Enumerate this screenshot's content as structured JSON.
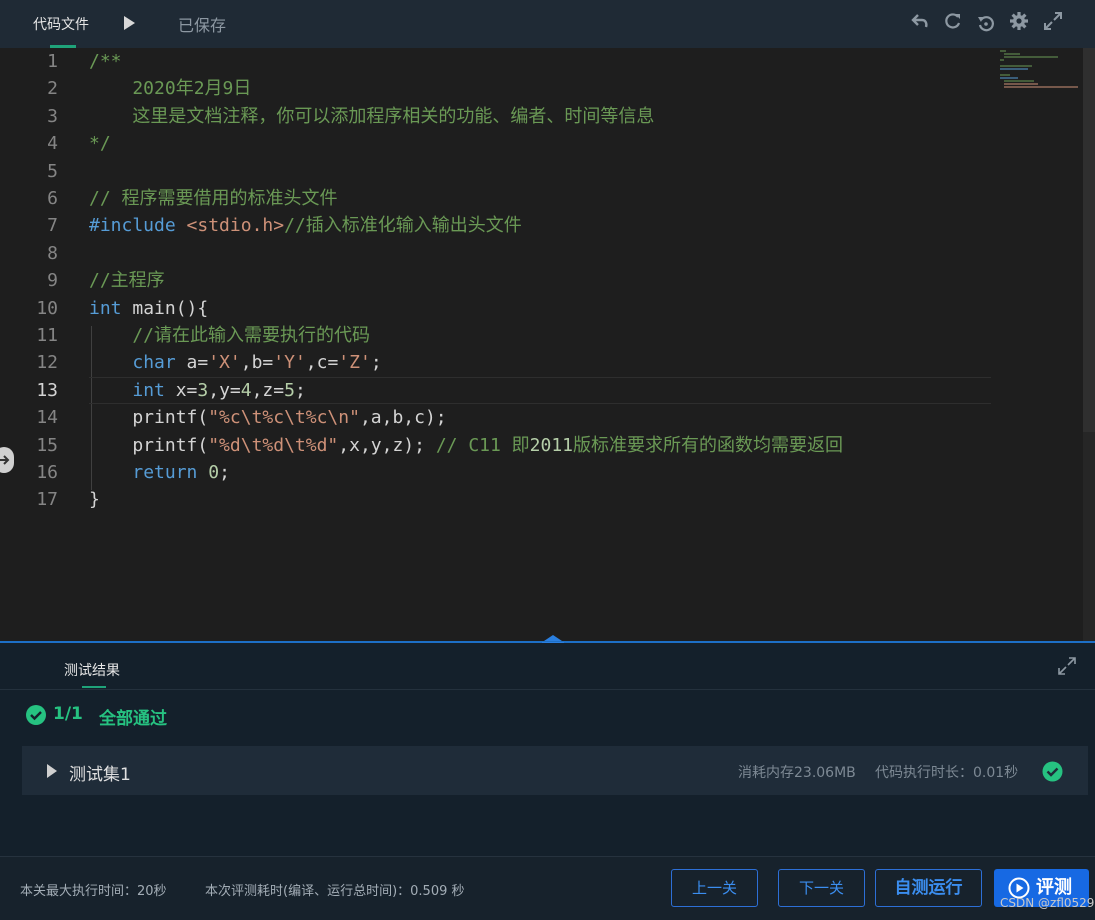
{
  "toolbar": {
    "file_tab": "代码文件",
    "saved_status": "已保存",
    "icons": [
      "undo-icon",
      "refresh-icon",
      "restore-icon",
      "settings-icon",
      "fullscreen-icon"
    ]
  },
  "editor": {
    "line_numbers": [
      "1",
      "2",
      "3",
      "4",
      "5",
      "6",
      "7",
      "8",
      "9",
      "10",
      "11",
      "12",
      "13",
      "14",
      "15",
      "16",
      "17"
    ],
    "active_line": "13",
    "lines": [
      [
        {
          "t": "/**",
          "c": "com"
        }
      ],
      [
        {
          "t": "    2020年2月9日",
          "c": "com"
        }
      ],
      [
        {
          "t": "    这里是文档注释，你可以添加程序相关的功能、编者、时间等信息",
          "c": "com"
        }
      ],
      [
        {
          "t": "*/",
          "c": "com"
        }
      ],
      [],
      [
        {
          "t": "// 程序需要借用的标准头文件",
          "c": "com"
        }
      ],
      [
        {
          "t": "#include ",
          "c": "inc"
        },
        {
          "t": "<stdio.h>",
          "c": "hdr"
        },
        {
          "t": "//插入标准化输入输出头文件",
          "c": "com"
        }
      ],
      [],
      [
        {
          "t": "//主程序",
          "c": "com"
        }
      ],
      [
        {
          "t": "int",
          "c": "kw"
        },
        {
          "t": " main(){",
          "c": "def"
        }
      ],
      [
        {
          "t": "    //请在此输入需要执行的代码",
          "c": "com"
        }
      ],
      [
        {
          "t": "    ",
          "c": "def"
        },
        {
          "t": "char",
          "c": "kw"
        },
        {
          "t": " a=",
          "c": "def"
        },
        {
          "t": "'X'",
          "c": "str"
        },
        {
          "t": ",b=",
          "c": "def"
        },
        {
          "t": "'Y'",
          "c": "str"
        },
        {
          "t": ",c=",
          "c": "def"
        },
        {
          "t": "'Z'",
          "c": "str"
        },
        {
          "t": ";",
          "c": "def"
        }
      ],
      [
        {
          "t": "    ",
          "c": "def"
        },
        {
          "t": "int",
          "c": "kw"
        },
        {
          "t": " x=",
          "c": "def"
        },
        {
          "t": "3",
          "c": "num"
        },
        {
          "t": ",y=",
          "c": "def"
        },
        {
          "t": "4",
          "c": "num"
        },
        {
          "t": ",z=",
          "c": "def"
        },
        {
          "t": "5",
          "c": "num"
        },
        {
          "t": ";",
          "c": "def"
        }
      ],
      [
        {
          "t": "    printf(",
          "c": "def"
        },
        {
          "t": "\"%c\\t%c\\t%c\\n\"",
          "c": "str"
        },
        {
          "t": ",a,b,c);",
          "c": "def"
        }
      ],
      [
        {
          "t": "    printf(",
          "c": "def"
        },
        {
          "t": "\"%d\\t%d\\t%d\"",
          "c": "str"
        },
        {
          "t": ",x,y,z); ",
          "c": "def"
        },
        {
          "t": "// C11 即",
          "c": "com"
        },
        {
          "t": "2011",
          "c": "num"
        },
        {
          "t": "版标准要求所有的函数均需要返回",
          "c": "com"
        }
      ],
      [
        {
          "t": "    ",
          "c": "def"
        },
        {
          "t": "return",
          "c": "kw"
        },
        {
          "t": " ",
          "c": "def"
        },
        {
          "t": "0",
          "c": "num"
        },
        {
          "t": ";",
          "c": "def"
        }
      ],
      [
        {
          "t": "}",
          "c": "def"
        }
      ]
    ]
  },
  "results": {
    "tab_label": "测试结果",
    "pass_count": "1/1",
    "pass_text": "全部通过",
    "test_set": {
      "name": "测试集1",
      "memory": "消耗内存23.06MB",
      "exec_time": "代码执行时长：0.01秒"
    }
  },
  "footer": {
    "max_exec_time": "本关最大执行时间：20秒",
    "judge_time": "本次评测耗时(编译、运行总时间)：0.509 秒",
    "prev_label": "上一关",
    "next_label": "下一关",
    "self_run_label": "自测运行",
    "judge_label": "评测"
  },
  "watermark": "CSDN @zfl0529",
  "colors": {
    "accent_green": "#26c281",
    "primary_blue": "#1769e3",
    "editor_bg": "#1e1e1e",
    "panel_bg": "#14202b"
  }
}
